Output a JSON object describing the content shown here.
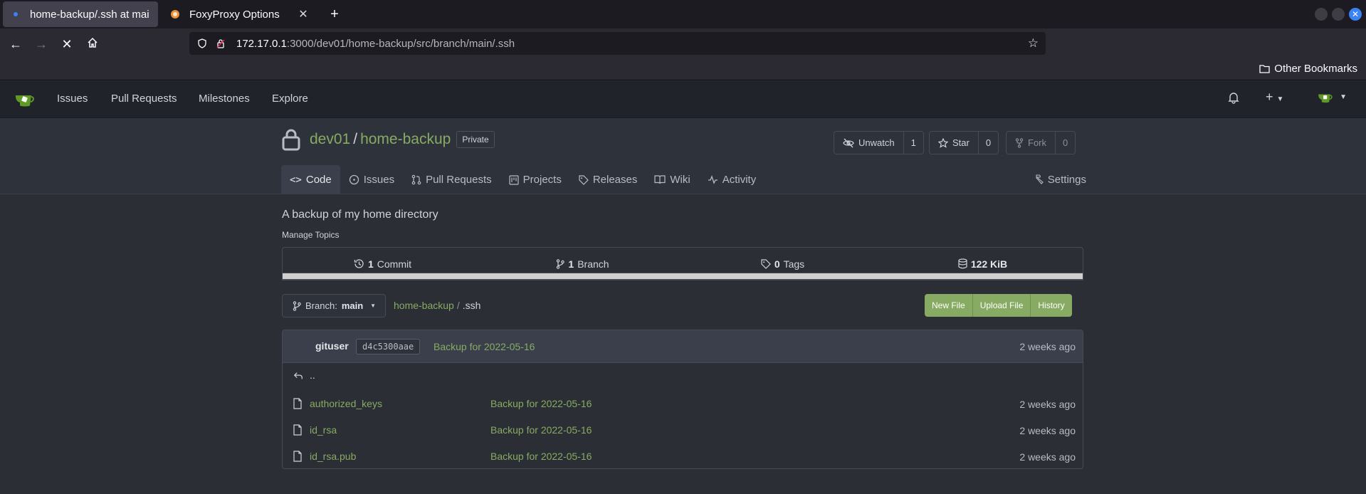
{
  "browser": {
    "tabs": [
      {
        "title": "home-backup/.ssh at mai",
        "active": true
      },
      {
        "title": "FoxyProxy Options",
        "active": false
      }
    ],
    "url_host": "172.17.0.1",
    "url_path": ":3000/dev01/home-backup/src/branch/main/.ssh",
    "bookmarks_folder": "Other Bookmarks"
  },
  "gitea_nav": {
    "items": [
      "Issues",
      "Pull Requests",
      "Milestones",
      "Explore"
    ],
    "plus": "+"
  },
  "repo": {
    "owner": "dev01",
    "name": "home-backup",
    "separator": "/",
    "visibility": "Private",
    "watch": {
      "label": "Unwatch",
      "count": "1"
    },
    "star": {
      "label": "Star",
      "count": "0"
    },
    "fork": {
      "label": "Fork",
      "count": "0"
    },
    "tabs": {
      "code": "Code",
      "issues": "Issues",
      "pulls": "Pull Requests",
      "projects": "Projects",
      "releases": "Releases",
      "wiki": "Wiki",
      "activity": "Activity",
      "settings": "Settings"
    },
    "description": "A backup of my home directory",
    "manage_topics": "Manage Topics",
    "stats": {
      "commits_num": "1",
      "commits_label": "Commit",
      "branches_num": "1",
      "branches_label": "Branch",
      "tags_num": "0",
      "tags_label": "Tags",
      "size": "122 KiB"
    }
  },
  "browse": {
    "branch_label": "Branch:",
    "branch_name": "main",
    "breadcrumb_root": "home-backup",
    "breadcrumb_sep": "/",
    "breadcrumb_current": ".ssh",
    "actions": {
      "new_file": "New File",
      "upload_file": "Upload File",
      "history": "History"
    }
  },
  "latest_commit": {
    "user": "gituser",
    "sha": "d4c5300aae",
    "message": "Backup for 2022-05-16",
    "time": "2 weeks ago"
  },
  "parent_dir": "..",
  "files": [
    {
      "name": "authorized_keys",
      "message": "Backup for 2022-05-16",
      "time": "2 weeks ago"
    },
    {
      "name": "id_rsa",
      "message": "Backup for 2022-05-16",
      "time": "2 weeks ago"
    },
    {
      "name": "id_rsa.pub",
      "message": "Backup for 2022-05-16",
      "time": "2 weeks ago"
    }
  ],
  "colors": {
    "accent": "#87ab63",
    "background": "#2b2e35",
    "header": "#202329"
  }
}
